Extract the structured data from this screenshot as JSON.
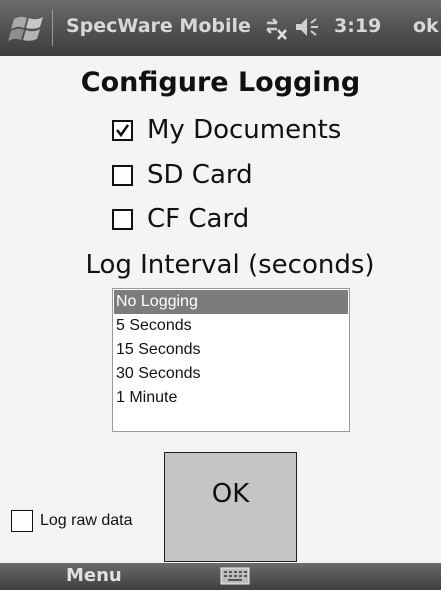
{
  "titlebar": {
    "app_title": "SpecWare Mobile",
    "clock": "3:19",
    "ok_label": "ok",
    "icons": [
      "windows-start-icon",
      "connectivity-icon",
      "volume-icon"
    ]
  },
  "dialog": {
    "heading": "Configure Logging",
    "locations": [
      {
        "label": "My Documents",
        "checked": true
      },
      {
        "label": "SD Card",
        "checked": false
      },
      {
        "label": "CF Card",
        "checked": false
      }
    ],
    "interval_label": "Log Interval (seconds)",
    "interval_options": [
      "No Logging",
      "5 Seconds",
      "15 Seconds",
      "30 Seconds",
      "1 Minute"
    ],
    "selected_interval": "No Logging",
    "raw_data_label": "Log raw data",
    "raw_data_checked": false,
    "ok_button": "OK"
  },
  "softkeys": {
    "left": "Menu",
    "center_icon": "keyboard-icon"
  },
  "colors": {
    "titlebar": "#555555",
    "selection": "#7c7c7c",
    "button": "#c5c5c5",
    "background": "#f4f4f4"
  }
}
